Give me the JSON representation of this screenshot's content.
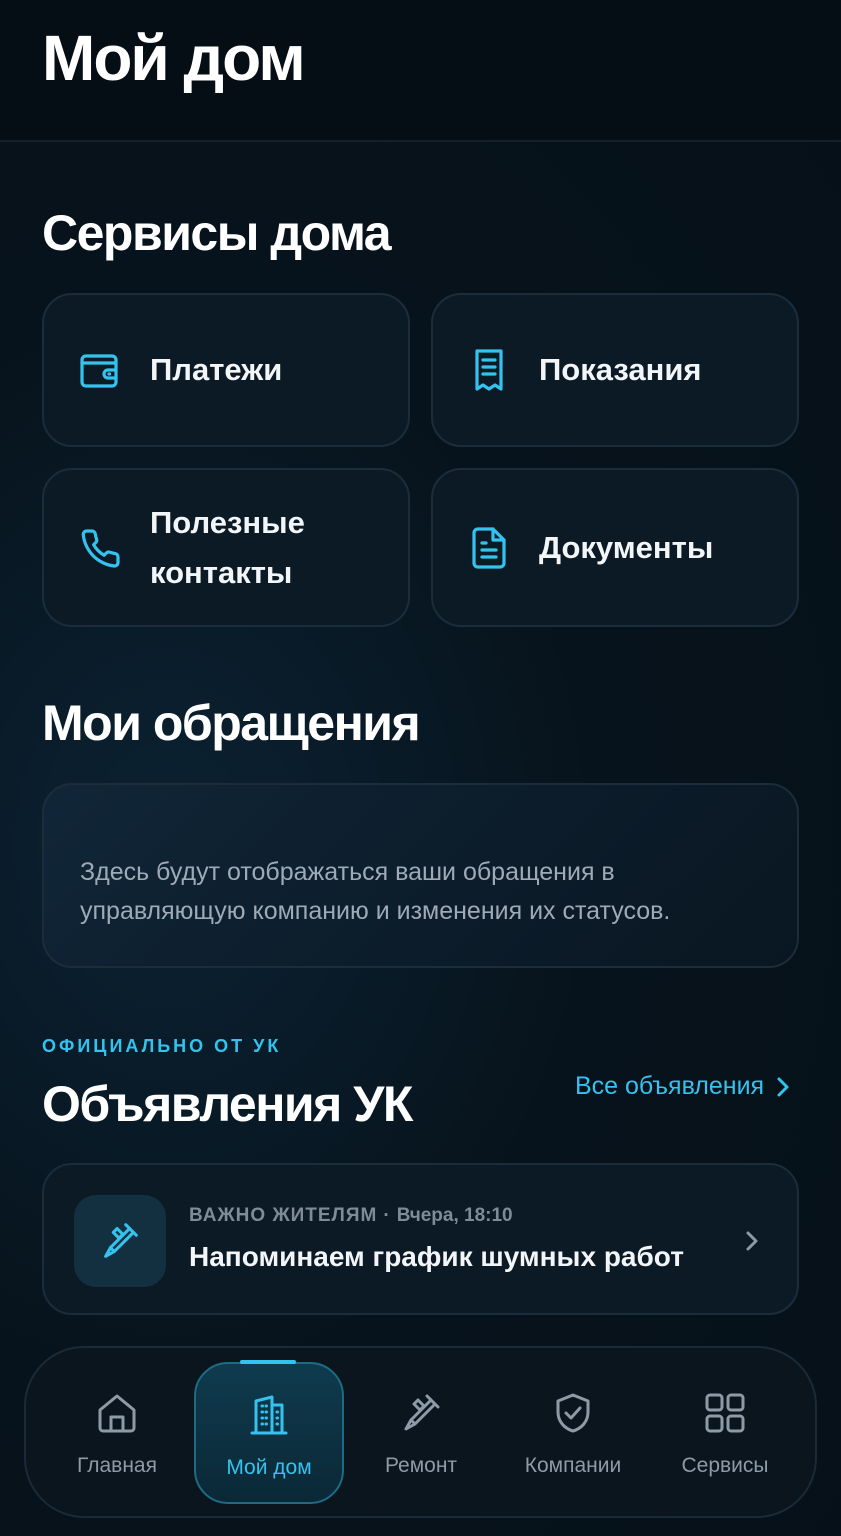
{
  "header": {
    "title": "Мой дом"
  },
  "services": {
    "title": "Сервисы дома",
    "tiles": [
      {
        "label": "Платежи",
        "icon": "wallet-icon"
      },
      {
        "label": "Показания",
        "icon": "receipt-icon"
      },
      {
        "label": "Полезные контакты",
        "icon": "phone-icon"
      },
      {
        "label": "Документы",
        "icon": "document-icon"
      }
    ]
  },
  "requests": {
    "title": "Мои обращения",
    "empty_text": "Здесь будут отображаться ваши обращения в управляющую компанию и изменения их статусов."
  },
  "announcements": {
    "eyebrow": "ОФИЦИАЛЬНО ОТ УК",
    "title": "Объявления УК",
    "see_all": "Все объявления",
    "items": [
      {
        "category": "ВАЖНО ЖИТЕЛЯМ",
        "separator": "·",
        "time": "Вчера, 18:10",
        "title": "Напоминаем график шумных работ",
        "icon": "tools-icon"
      }
    ]
  },
  "tabbar": {
    "active": "Мой дом",
    "tabs": [
      {
        "label": "Главная",
        "icon": "home-icon"
      },
      {
        "label": "Мой дом",
        "icon": "building-icon"
      },
      {
        "label": "Ремонт",
        "icon": "tools-icon"
      },
      {
        "label": "Компании",
        "icon": "shield-check-icon"
      },
      {
        "label": "Сервисы",
        "icon": "grid-icon"
      }
    ]
  },
  "colors": {
    "accent": "#33c3ee",
    "background": "#07121b",
    "card": "#0c1a25",
    "muted": "#8e9aa5"
  }
}
